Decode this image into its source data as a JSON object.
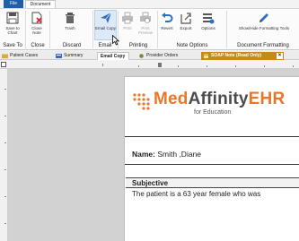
{
  "ribbon": {
    "tabs": [
      "File",
      "Document"
    ],
    "buttons": {
      "save_to_chart": "Save to Chart",
      "close_note": "Close Note",
      "trash": "Trash",
      "email_copy": "Email Copy",
      "print": "Print",
      "print_preview": "Print Preview",
      "revert": "Revert",
      "export": "Export",
      "options": "Options",
      "show_hide_formatting_tools": "Show/Hide Formatting Tools"
    },
    "groups": {
      "save_to": "Save To",
      "close": "Close",
      "discard": "Discard",
      "email": "Email",
      "printing": "Printing",
      "note_options": "Note Options",
      "document_formatting": "Document Formatting"
    }
  },
  "document_tabs": [
    {
      "label": "Patient Cases"
    },
    {
      "label": "Summary"
    },
    {
      "label": "Email Copy"
    },
    {
      "label": "Provider Orders"
    },
    {
      "label": "SOAP Note (Read Only)"
    }
  ],
  "document": {
    "logo": {
      "part1": "Med",
      "part2": "Affinity",
      "part3": "EHR",
      "subtitle": "for Education"
    },
    "name_label": "Name:",
    "patient_name": "Smith ,Diane",
    "section_title": "Subjective",
    "body_text": "The patient is a 63 year female who was"
  },
  "colors": {
    "file_tab": "#1f5fa8",
    "readonly_tab": "#c7881c",
    "logo_orange": "#e8762b",
    "accent_blue": "#2e6fc4"
  }
}
